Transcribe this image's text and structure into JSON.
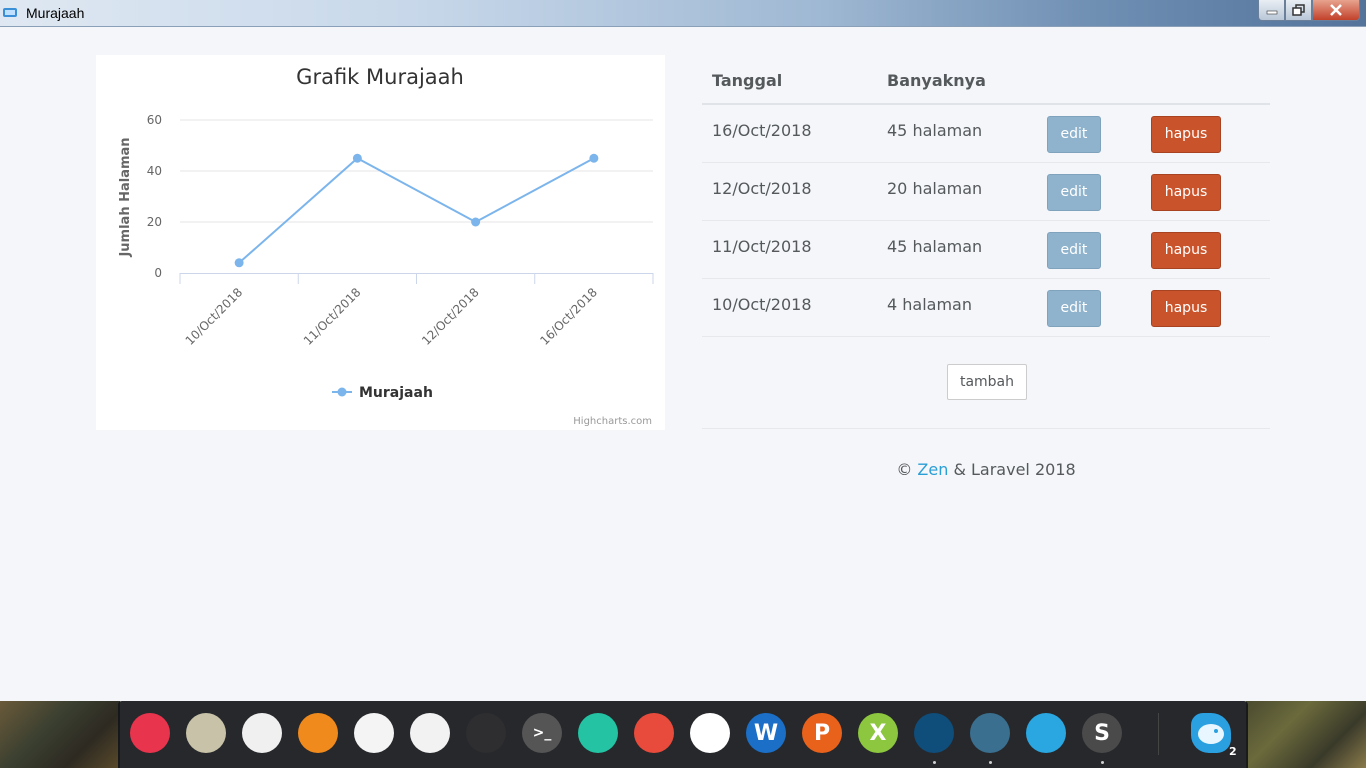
{
  "window": {
    "title": "Murajaah"
  },
  "chart_data": {
    "type": "line",
    "title": "Grafik Murajaah",
    "categories": [
      "10/Oct/2018",
      "11/Oct/2018",
      "12/Oct/2018",
      "16/Oct/2018"
    ],
    "series": [
      {
        "name": "Murajaah",
        "values": [
          4,
          45,
          20,
          45
        ],
        "color": "#7cb5ec"
      }
    ],
    "ylabel": "Jumlah Halaman",
    "xlabel": "",
    "ylim": [
      0,
      60
    ],
    "yticks": [
      0,
      20,
      40,
      60
    ],
    "grid": true,
    "legend": "bottom-center",
    "credits": "Highcharts.com"
  },
  "table": {
    "headers": [
      "Tanggal",
      "Banyaknya"
    ],
    "rows": [
      {
        "date": "16/Oct/2018",
        "amount": "45 halaman",
        "edit": "edit",
        "delete": "hapus"
      },
      {
        "date": "12/Oct/2018",
        "amount": "20 halaman",
        "edit": "edit",
        "delete": "hapus"
      },
      {
        "date": "11/Oct/2018",
        "amount": "45 halaman",
        "edit": "edit",
        "delete": "hapus"
      },
      {
        "date": "10/Oct/2018",
        "amount": "4 halaman",
        "edit": "edit",
        "delete": "hapus"
      }
    ]
  },
  "add_button": "tambah",
  "footer": {
    "prefix": "© ",
    "link": "Zen",
    "suffix": " & Laravel 2018",
    "link_color": "#2a9fd6"
  },
  "taskbar": {
    "items": [
      {
        "name": "windows-start-icon",
        "color": "#e8344d",
        "glyph": ""
      },
      {
        "name": "search-app-icon",
        "color": "#c8c2a8",
        "glyph": ""
      },
      {
        "name": "trash-icon",
        "color": "#f0f0f0",
        "glyph": ""
      },
      {
        "name": "vlc-icon",
        "color": "#f08a1c",
        "glyph": ""
      },
      {
        "name": "browser-g-icon",
        "color": "#f4f4f4",
        "glyph": ""
      },
      {
        "name": "disk-usage-icon",
        "color": "#f2f2f2",
        "glyph": ""
      },
      {
        "name": "draw-icon",
        "color": "#2e2e30",
        "glyph": ""
      },
      {
        "name": "terminal-icon",
        "color": "#555555",
        "glyph": ">_"
      },
      {
        "name": "monitor-icon",
        "color": "#23c3a4",
        "glyph": ""
      },
      {
        "name": "settings-icon",
        "color": "#e84b3c",
        "glyph": ""
      },
      {
        "name": "eclipse-icon",
        "color": "#ffffff",
        "glyph": ""
      },
      {
        "name": "word-icon",
        "color": "#1c6fc7",
        "glyph": "W"
      },
      {
        "name": "powerpoint-icon",
        "color": "#e8621c",
        "glyph": "P"
      },
      {
        "name": "excel-icon",
        "color": "#8dc63f",
        "glyph": "X"
      },
      {
        "name": "water-drop-icon",
        "color": "#0f4d7a",
        "glyph": ""
      },
      {
        "name": "file-manager-icon",
        "color": "#3a6f8f",
        "glyph": ""
      },
      {
        "name": "firefox-icon",
        "color": "#2aa6e0",
        "glyph": ""
      },
      {
        "name": "sublime-icon",
        "color": "#4a4a4a",
        "glyph": "S"
      }
    ],
    "badge": "2"
  }
}
